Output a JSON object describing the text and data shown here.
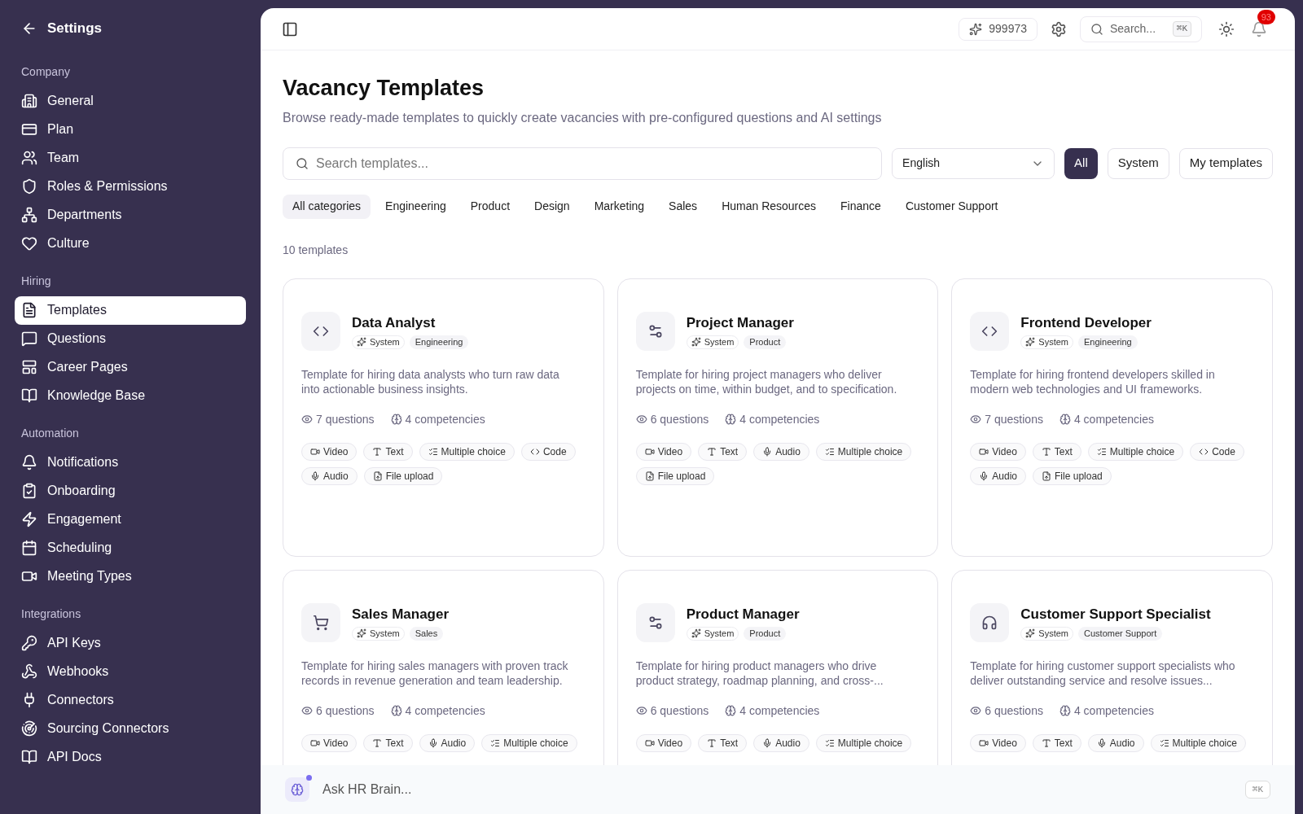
{
  "sidebar": {
    "title": "Settings",
    "sections": [
      {
        "heading": "Company",
        "items": [
          {
            "label": "General",
            "selected": false
          },
          {
            "label": "Plan",
            "selected": false
          },
          {
            "label": "Team",
            "selected": false
          },
          {
            "label": "Roles & Permissions",
            "selected": false
          },
          {
            "label": "Departments",
            "selected": false
          },
          {
            "label": "Culture",
            "selected": false
          }
        ]
      },
      {
        "heading": "Hiring",
        "items": [
          {
            "label": "Templates",
            "selected": true
          },
          {
            "label": "Questions",
            "selected": false
          },
          {
            "label": "Career Pages",
            "selected": false
          },
          {
            "label": "Knowledge Base",
            "selected": false
          }
        ]
      },
      {
        "heading": "Automation",
        "items": [
          {
            "label": "Notifications",
            "selected": false
          },
          {
            "label": "Onboarding",
            "selected": false
          },
          {
            "label": "Engagement",
            "selected": false
          },
          {
            "label": "Scheduling",
            "selected": false
          },
          {
            "label": "Meeting Types",
            "selected": false
          }
        ]
      },
      {
        "heading": "Integrations",
        "items": [
          {
            "label": "API Keys",
            "selected": false
          },
          {
            "label": "Webhooks",
            "selected": false
          },
          {
            "label": "Connectors",
            "selected": false
          },
          {
            "label": "Sourcing Connectors",
            "selected": false
          },
          {
            "label": "API Docs",
            "selected": false
          }
        ]
      }
    ]
  },
  "topbar": {
    "credits": "999973",
    "search_placeholder": "Search...",
    "shortcut": "⌘K",
    "notification_count": "93"
  },
  "page": {
    "title": "Vacancy Templates",
    "subtitle": "Browse ready-made templates to quickly create vacancies with pre-configured questions and AI settings"
  },
  "filters": {
    "search_placeholder": "Search templates...",
    "language": "English",
    "scopes": [
      {
        "label": "All",
        "selected": true
      },
      {
        "label": "System",
        "selected": false
      },
      {
        "label": "My templates",
        "selected": false
      }
    ],
    "categories": [
      {
        "label": "All categories",
        "selected": true
      },
      {
        "label": "Engineering",
        "selected": false
      },
      {
        "label": "Product",
        "selected": false
      },
      {
        "label": "Design",
        "selected": false
      },
      {
        "label": "Marketing",
        "selected": false
      },
      {
        "label": "Sales",
        "selected": false
      },
      {
        "label": "Human Resources",
        "selected": false
      },
      {
        "label": "Finance",
        "selected": false
      },
      {
        "label": "Customer Support",
        "selected": false
      }
    ]
  },
  "count": "10 templates",
  "templates": [
    {
      "title": "Data Analyst",
      "source": "System",
      "category": "Engineering",
      "description": "Template for hiring data analysts who turn raw data into actionable business insights.",
      "questions": "7 questions",
      "competencies": "4 competencies",
      "types": [
        {
          "kind": "video",
          "label": "Video"
        },
        {
          "kind": "text",
          "label": "Text"
        },
        {
          "kind": "choice",
          "label": "Multiple choice"
        },
        {
          "kind": "code",
          "label": "Code"
        },
        {
          "kind": "audio",
          "label": "Audio"
        },
        {
          "kind": "file",
          "label": "File upload"
        }
      ]
    },
    {
      "title": "Project Manager",
      "source": "System",
      "category": "Product",
      "description": "Template for hiring project managers who deliver projects on time, within budget, and to specification.",
      "questions": "6 questions",
      "competencies": "4 competencies",
      "types": [
        {
          "kind": "video",
          "label": "Video"
        },
        {
          "kind": "text",
          "label": "Text"
        },
        {
          "kind": "audio",
          "label": "Audio"
        },
        {
          "kind": "choice",
          "label": "Multiple choice"
        },
        {
          "kind": "file",
          "label": "File upload"
        }
      ]
    },
    {
      "title": "Frontend Developer",
      "source": "System",
      "category": "Engineering",
      "description": "Template for hiring frontend developers skilled in modern web technologies and UI frameworks.",
      "questions": "7 questions",
      "competencies": "4 competencies",
      "types": [
        {
          "kind": "video",
          "label": "Video"
        },
        {
          "kind": "text",
          "label": "Text"
        },
        {
          "kind": "choice",
          "label": "Multiple choice"
        },
        {
          "kind": "code",
          "label": "Code"
        },
        {
          "kind": "audio",
          "label": "Audio"
        },
        {
          "kind": "file",
          "label": "File upload"
        }
      ]
    },
    {
      "title": "Sales Manager",
      "source": "System",
      "category": "Sales",
      "description": "Template for hiring sales managers with proven track records in revenue generation and team leadership.",
      "questions": "6 questions",
      "competencies": "4 competencies",
      "types": [
        {
          "kind": "video",
          "label": "Video"
        },
        {
          "kind": "text",
          "label": "Text"
        },
        {
          "kind": "audio",
          "label": "Audio"
        },
        {
          "kind": "choice",
          "label": "Multiple choice"
        }
      ]
    },
    {
      "title": "Product Manager",
      "source": "System",
      "category": "Product",
      "description": "Template for hiring product managers who drive product strategy, roadmap planning, and cross-...",
      "questions": "6 questions",
      "competencies": "4 competencies",
      "types": [
        {
          "kind": "video",
          "label": "Video"
        },
        {
          "kind": "text",
          "label": "Text"
        },
        {
          "kind": "audio",
          "label": "Audio"
        },
        {
          "kind": "choice",
          "label": "Multiple choice"
        }
      ]
    },
    {
      "title": "Customer Support Specialist",
      "source": "System",
      "category": "Customer Support",
      "description": "Template for hiring customer support specialists who deliver outstanding service and resolve issues...",
      "questions": "6 questions",
      "competencies": "4 competencies",
      "types": [
        {
          "kind": "video",
          "label": "Video"
        },
        {
          "kind": "text",
          "label": "Text"
        },
        {
          "kind": "audio",
          "label": "Audio"
        },
        {
          "kind": "choice",
          "label": "Multiple choice"
        }
      ]
    }
  ],
  "assistant": {
    "placeholder": "Ask HR Brain...",
    "shortcut": "⌘K"
  }
}
